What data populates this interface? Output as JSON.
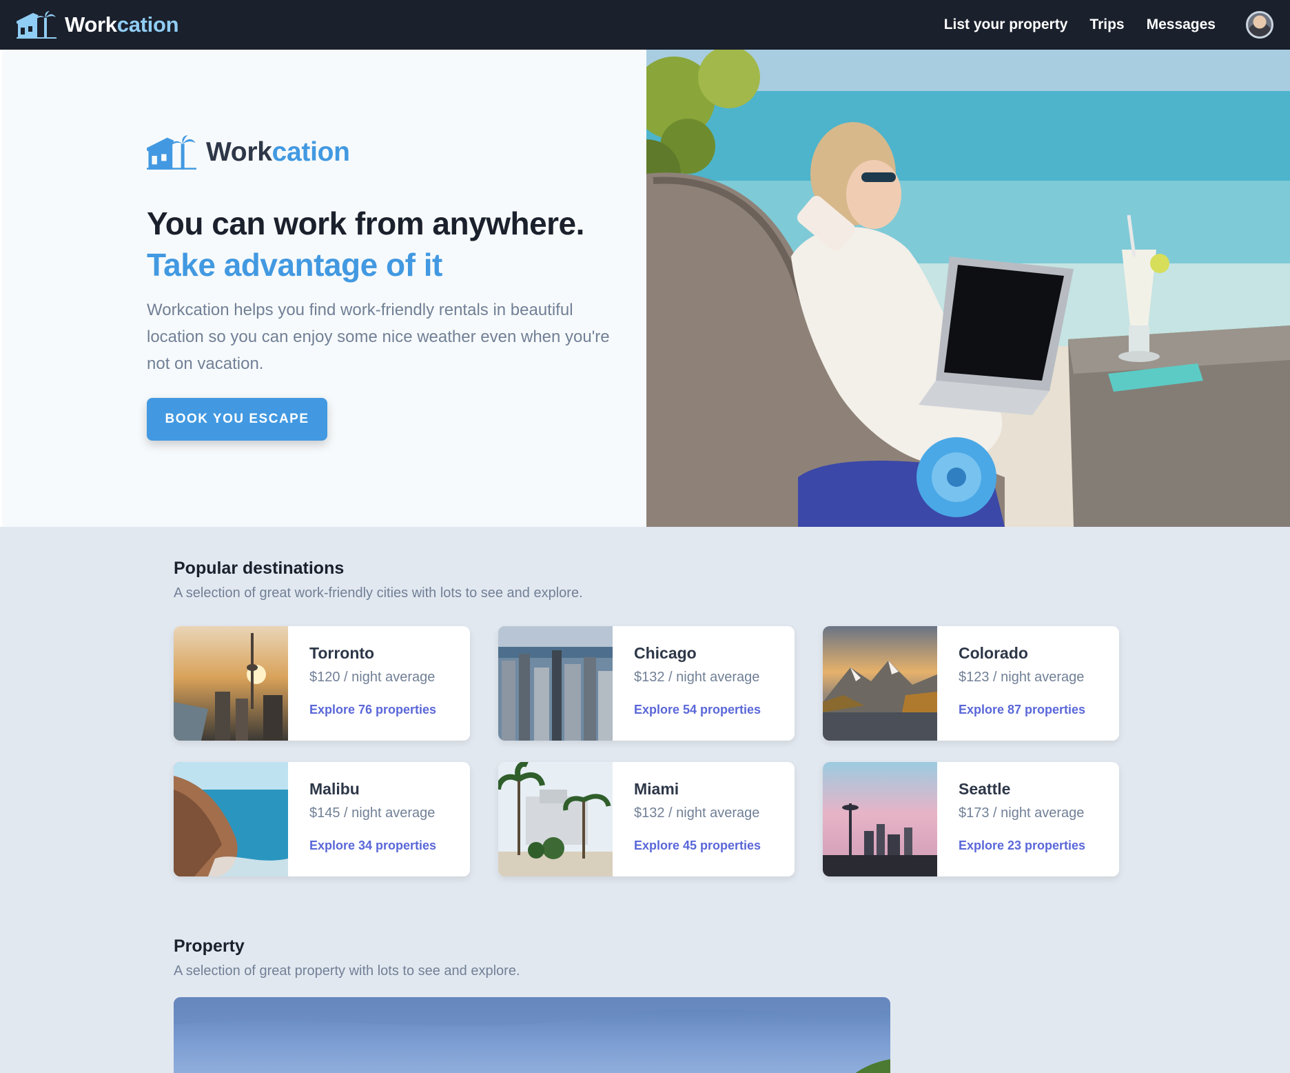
{
  "navbar": {
    "brand": {
      "part1": "Work",
      "part2": "cation"
    },
    "links": [
      "List your property",
      "Trips",
      "Messages"
    ]
  },
  "hero": {
    "brand": {
      "part1": "Work",
      "part2": "cation"
    },
    "headline_line1": "You can work from anywhere.",
    "headline_line2": "Take advantage of it",
    "description": "Workcation helps you find work-friendly rentals in beautiful location so you can enjoy some nice weather even when you're not on vacation.",
    "cta_label": "Book you escape"
  },
  "destinations": {
    "title": "Popular destinations",
    "subtitle": "A selection of great work-friendly cities with lots to see and explore.",
    "cards": [
      {
        "name": "Torronto",
        "price": "$120 / night average",
        "link": "Explore 76 properties"
      },
      {
        "name": "Chicago",
        "price": "$132 / night average",
        "link": "Explore 54 properties"
      },
      {
        "name": "Colorado",
        "price": "$123 / night average",
        "link": "Explore 87 properties"
      },
      {
        "name": "Malibu",
        "price": "$145 / night average",
        "link": "Explore 34 properties"
      },
      {
        "name": "Miami",
        "price": "$132 / night average",
        "link": "Explore 45 properties"
      },
      {
        "name": "Seattle",
        "price": "$173 / night average",
        "link": "Explore 23 properties"
      }
    ]
  },
  "property": {
    "title": "Property",
    "subtitle": "A selection of great property with lots to see and explore."
  },
  "colors": {
    "nav_bg": "#1a202c",
    "brand_blue": "#4299e1",
    "brand_light_blue": "#90cdf4",
    "link_indigo": "#5a67d8",
    "section_bg": "#e2e8f0"
  }
}
